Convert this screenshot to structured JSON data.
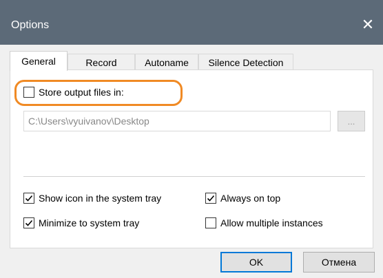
{
  "window": {
    "title": "Options",
    "close_icon": "close-icon"
  },
  "tabs": [
    {
      "label": "General",
      "active": true
    },
    {
      "label": "Record",
      "active": false
    },
    {
      "label": "Autoname",
      "active": false
    },
    {
      "label": "Silence Detection",
      "active": false
    }
  ],
  "general": {
    "store_output": {
      "label": "Store output files in:",
      "checked": false
    },
    "output_path": {
      "value": "C:\\Users\\vyuivanov\\Desktop"
    },
    "browse_label": "...",
    "options": [
      {
        "label": "Show icon in the system tray",
        "checked": true
      },
      {
        "label": "Always on top",
        "checked": true
      },
      {
        "label": "Minimize to system tray",
        "checked": true
      },
      {
        "label": "Allow multiple instances",
        "checked": false
      }
    ]
  },
  "buttons": {
    "ok_label": "OK",
    "cancel_label": "Отмена"
  },
  "colors": {
    "titlebar": "#5c6a78",
    "highlight": "#f08a24",
    "default_button_border": "#0078d7"
  }
}
